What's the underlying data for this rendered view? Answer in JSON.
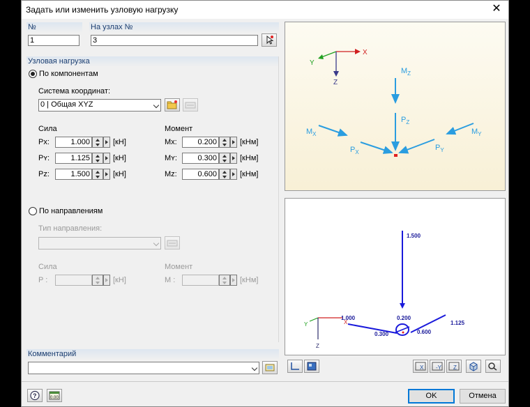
{
  "window": {
    "title": "Задать или изменить узловую нагрузку"
  },
  "header": {
    "no_label": "№",
    "no_value": "1",
    "nodes_label": "На узлах №",
    "nodes_value": "3"
  },
  "nodal_load": {
    "group_title": "Узловая нагрузка",
    "by_components": {
      "label": "По компонентам",
      "selected": true,
      "coord_label": "Система координат:",
      "coord_value": "0 | Общая XYZ",
      "force_label": "Сила",
      "moment_label": "Момент",
      "forces": [
        {
          "label": "Px:",
          "value": "1.000",
          "unit": "[кН]"
        },
        {
          "label": "Pʏ:",
          "value": "1.125",
          "unit": "[кН]"
        },
        {
          "label": "Pz:",
          "value": "1.500",
          "unit": "[кН]"
        }
      ],
      "moments": [
        {
          "label": "Mx:",
          "value": "0.200",
          "unit": "[кНм]"
        },
        {
          "label": "Mʏ:",
          "value": "0.300",
          "unit": "[кНм]"
        },
        {
          "label": "Mz:",
          "value": "0.600",
          "unit": "[кНм]"
        }
      ]
    },
    "by_directions": {
      "label": "По направлениям",
      "selected": false,
      "dir_type_label": "Тип направления:",
      "dir_type_value": "",
      "force_label": "Сила",
      "p_label": "P :",
      "p_value": "",
      "p_unit": "[кН]",
      "moment_label": "Момент",
      "m_label": "M :",
      "m_value": "",
      "m_unit": "[кНм]"
    }
  },
  "comment": {
    "group_title": "Комментарий",
    "value": ""
  },
  "diagram": {
    "axes": {
      "x": "X",
      "y": "Y",
      "z": "Z"
    },
    "labels": {
      "mz": "M",
      "mz_sub": "Z",
      "pz": "P",
      "pz_sub": "Z",
      "mx": "M",
      "mx_sub": "X",
      "px": "P",
      "px_sub": "X",
      "my": "M",
      "my_sub": "Y",
      "py": "P",
      "py_sub": "Y"
    },
    "accent_color": "#2a9de0"
  },
  "preview": {
    "axes": {
      "x": "X",
      "y": "Y",
      "z": "Z"
    },
    "values": {
      "pz": "1.500",
      "px": "1.000",
      "py": "1.125",
      "mx": "0.200",
      "my": "0.300",
      "mz": "0.600"
    },
    "load_color": "#1a1adb"
  },
  "footer": {
    "ok_label": "OK",
    "cancel_label": "Отмена"
  }
}
